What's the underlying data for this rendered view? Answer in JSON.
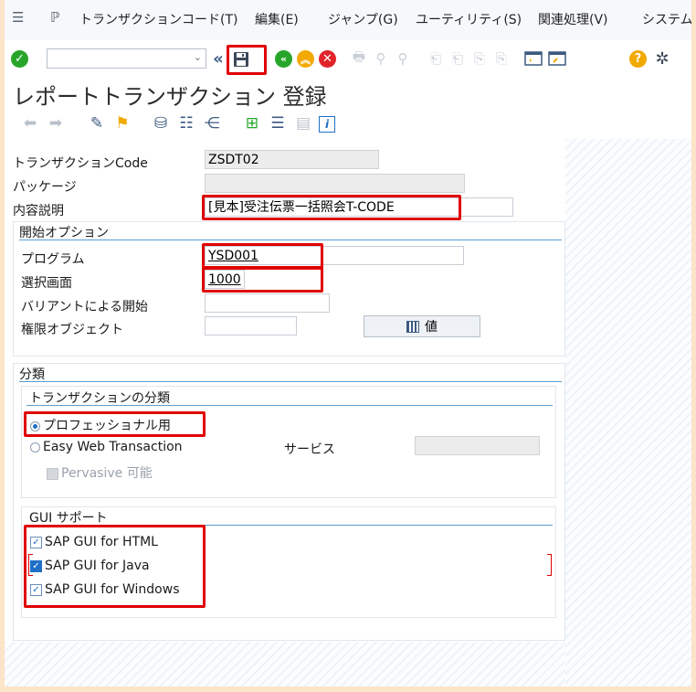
{
  "menu": {
    "items": [
      "トランザクションコード(T)",
      "編集(E)",
      "ジャンプ(G)",
      "ユーティリティ(S)",
      "関連処理(V)",
      "システム"
    ]
  },
  "toolbar": {
    "command_field_value": "",
    "icons": [
      "enter-icon",
      "back-history-icon",
      "save-icon",
      "back-icon",
      "exit-icon",
      "cancel-icon",
      "print-icon",
      "find-icon",
      "find-next-icon",
      "first-page-icon",
      "prev-page-icon",
      "next-page-icon",
      "last-page-icon",
      "new-session-icon",
      "shortcut-icon",
      "help-icon",
      "settings-icon"
    ]
  },
  "title": "レポートトランザクション 登録",
  "header_fields": {
    "tcode_label": "トランザクションCode",
    "tcode_value": "ZSDT02",
    "package_label": "パッケージ",
    "package_value": "",
    "description_label": "内容説明",
    "description_value": "[見本]受注伝票一括照会T-CODE"
  },
  "start_options": {
    "title": "開始オプション",
    "program_label": "プログラム",
    "program_value": "YSD001",
    "screen_label": "選択画面",
    "screen_value": "1000",
    "variant_label": "バリアントによる開始",
    "variant_value": "",
    "auth_label": "権限オブジェクト",
    "auth_value": "",
    "values_button": "値"
  },
  "classification": {
    "title": "分類",
    "tx_class_title": "トランザクションの分類",
    "radio_professional": "プロフェッショナル用",
    "radio_easy_web": "Easy Web Transaction",
    "service_label": "サービス",
    "service_value": "",
    "pervasive_label": "Pervasive 可能",
    "selected_radio": "プロフェッショナル用"
  },
  "gui_support": {
    "title": "GUI サポート",
    "items": [
      {
        "label": "SAP GUI for HTML",
        "checked": true
      },
      {
        "label": "SAP GUI for Java",
        "checked": true
      },
      {
        "label": "SAP GUI for Windows",
        "checked": true
      }
    ]
  },
  "colors": {
    "highlight_red": "#e00000",
    "accent_blue": "#1f6fc6",
    "enter_green": "#27a52a",
    "exit_orange": "#f2a900",
    "cancel_red": "#e0242a"
  }
}
